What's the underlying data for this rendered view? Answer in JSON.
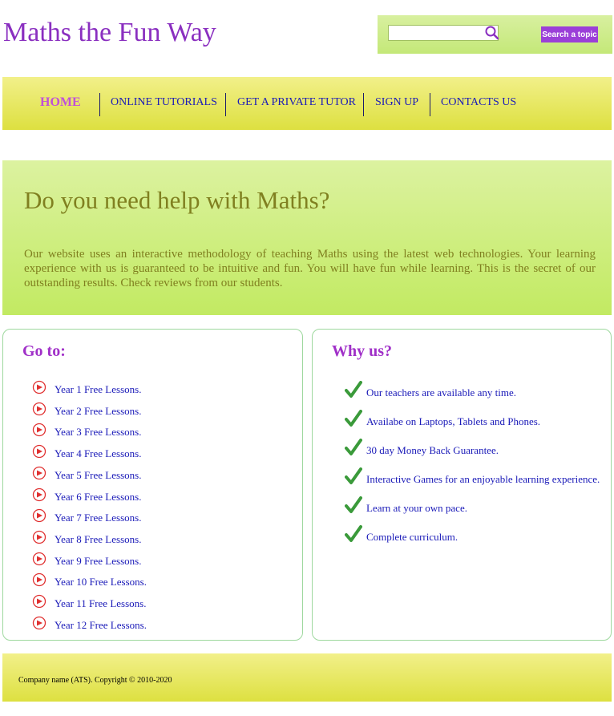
{
  "site": {
    "title": "Maths the Fun Way"
  },
  "search": {
    "placeholder": "",
    "value": "",
    "button_label": "Search a topic"
  },
  "nav": {
    "items": [
      {
        "label": "HOME",
        "active": true
      },
      {
        "label": "ONLINE TUTORIALS",
        "active": false
      },
      {
        "label": "GET A PRIVATE TUTOR",
        "active": false
      },
      {
        "label": "SIGN UP",
        "active": false
      },
      {
        "label": "CONTACTS US",
        "active": false
      }
    ]
  },
  "hero": {
    "title": "Do you need help with Maths?",
    "text": "Our website uses an interactive methodology of teaching Maths using the latest web technologies. Your learning experience with us is guaranteed to be intuitive and fun. You will have fun while learning. This is the secret of our outstanding results. Check reviews from our students."
  },
  "goto": {
    "heading": "Go to:",
    "items": [
      "Year 1 Free Lessons.",
      "Year 2 Free Lessons.",
      "Year 3 Free Lessons.",
      "Year 4 Free Lessons.",
      "Year 5 Free Lessons.",
      "Year 6 Free Lessons.",
      "Year 7 Free Lessons.",
      "Year 8 Free Lessons.",
      "Year 9 Free Lessons.",
      "Year 10 Free Lessons.",
      "Year 11 Free Lessons.",
      "Year 12 Free Lessons."
    ]
  },
  "why": {
    "heading": "Why us?",
    "items": [
      "Our teachers are available any time.",
      "Availabe on Laptops, Tablets and Phones.",
      "30 day Money Back Guarantee.",
      "Interactive Games for an enjoyable learning experience.",
      "Learn at your own pace.",
      "Complete curriculum."
    ]
  },
  "footer": {
    "text": "Company name (ATS). Copyright © 2010-2020"
  },
  "icons": {
    "search": "magnifier-icon",
    "goto_bullet": "arrow-circle-icon",
    "why_bullet": "check-icon"
  },
  "colors": {
    "brand": "#8a2fc0",
    "link": "#1a1ab8",
    "accent_green": "#c2ea62",
    "accent_yellow": "#dde040"
  }
}
